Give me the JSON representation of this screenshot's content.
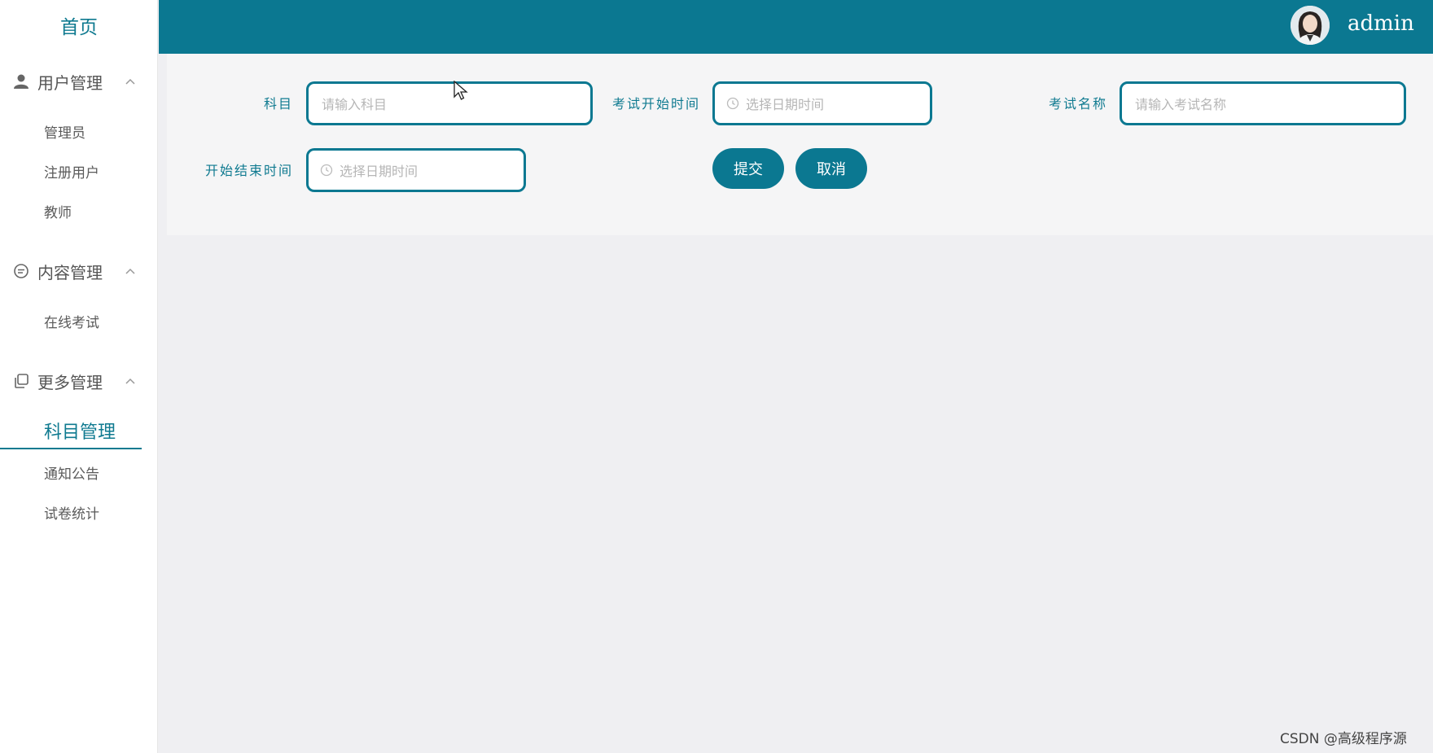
{
  "sidebar": {
    "home": "首页",
    "groups": [
      {
        "label": "用户管理",
        "icon": "user-icon",
        "items": [
          "管理员",
          "注册用户",
          "教师"
        ]
      },
      {
        "label": "内容管理",
        "icon": "chat-icon",
        "items": [
          "在线考试"
        ]
      },
      {
        "label": "更多管理",
        "icon": "copy-icon",
        "items": [
          "科目管理",
          "通知公告",
          "试卷统计"
        ]
      }
    ],
    "active_item": "科目管理"
  },
  "header": {
    "username": "admin",
    "avatar_icon": "avatar"
  },
  "form": {
    "subject": {
      "label": "科目",
      "placeholder": "请输入科目"
    },
    "exam_start_time": {
      "label": "考试开始时间",
      "placeholder": "选择日期时间"
    },
    "exam_name": {
      "label": "考试名称",
      "placeholder": "请输入考试名称"
    },
    "start_end_time": {
      "label": "开始结束时间",
      "placeholder": "选择日期时间"
    },
    "submit_label": "提交",
    "cancel_label": "取消"
  },
  "watermark": "CSDN @高级程序源",
  "colors": {
    "primary": "#0b7891",
    "sidebar_bg": "#ffffff",
    "content_bg": "#efeff2",
    "panel_bg": "#f5f5f6"
  }
}
